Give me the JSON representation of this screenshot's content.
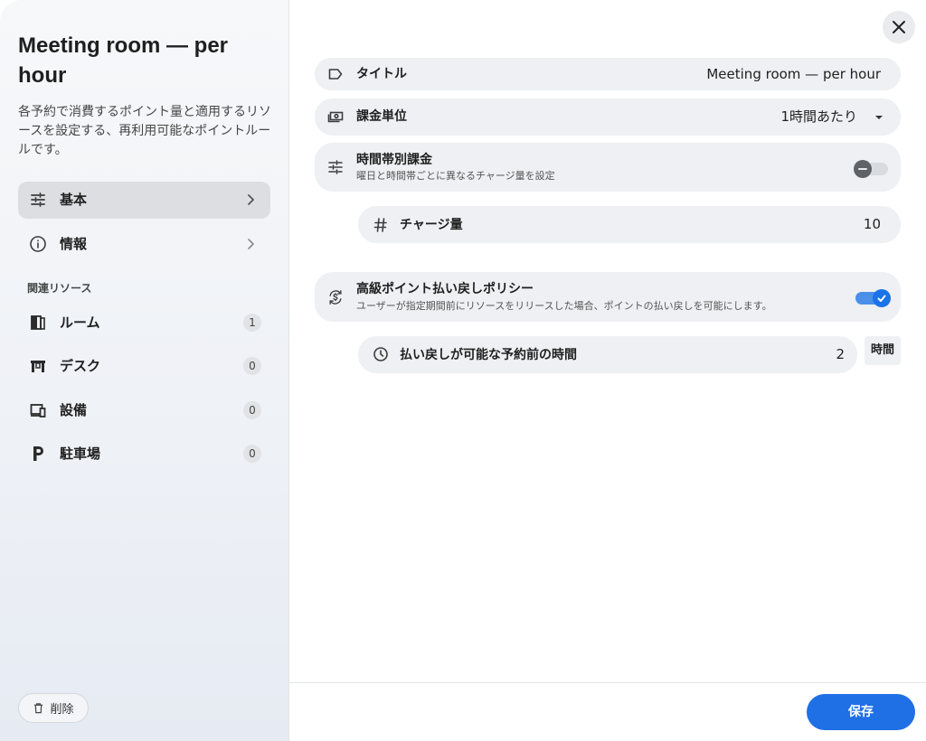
{
  "dialog": {
    "title": "Meeting room — per hour",
    "description": "各予約で消費するポイント量と適用するリソースを設定する、再利用可能なポイントルールです。"
  },
  "sidebar": {
    "nav": [
      {
        "label": "基本",
        "icon": "tune-icon",
        "active": true
      },
      {
        "label": "情報",
        "icon": "info-icon",
        "active": false
      }
    ],
    "section_label": "関連リソース",
    "resources": [
      {
        "label": "ルーム",
        "icon": "room-icon",
        "count": "1"
      },
      {
        "label": "デスク",
        "icon": "desk-icon",
        "count": "0"
      },
      {
        "label": "設備",
        "icon": "devices-icon",
        "count": "0"
      },
      {
        "label": "駐車場",
        "icon": "parking-icon",
        "count": "0"
      }
    ],
    "delete_label": "削除"
  },
  "form": {
    "title_label": "タイトル",
    "title_value": "Meeting room — per hour",
    "billing_unit_label": "課金単位",
    "billing_unit_value": "1時間あたり",
    "time_based_label": "時間帯別課金",
    "time_based_sub": "曜日と時間帯ごとに異なるチャージ量を設定",
    "time_based_enabled": false,
    "charge_label": "チャージ量",
    "charge_value": "10",
    "refund_label": "高級ポイント払い戻しポリシー",
    "refund_sub": "ユーザーが指定期間前にリソースをリリースした場合、ポイントの払い戻しを可能にします。",
    "refund_enabled": true,
    "refund_time_label": "払い戻しが可能な予約前の時間",
    "refund_time_value": "2",
    "refund_time_unit": "時間"
  },
  "footer": {
    "save_label": "保存"
  },
  "colors": {
    "accent": "#1f6fe5",
    "toggle_on": "#1a73e8"
  }
}
